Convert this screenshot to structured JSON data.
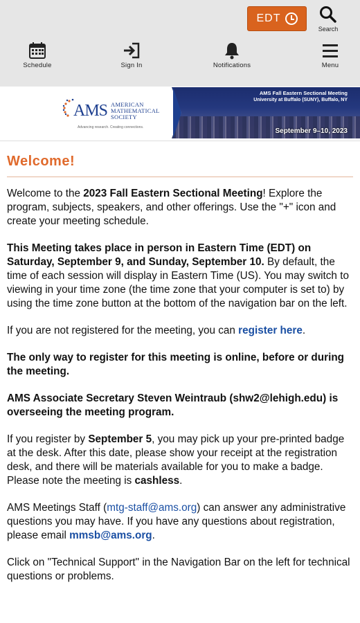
{
  "topbar": {
    "timezone_label": "EDT",
    "search_label": "Search",
    "nav": [
      {
        "label": "Schedule",
        "icon": "calendar-icon"
      },
      {
        "label": "Sign In",
        "icon": "sign-in-icon"
      },
      {
        "label": "Notifications",
        "icon": "bell-icon"
      },
      {
        "label": "Menu",
        "icon": "hamburger-icon"
      }
    ]
  },
  "banner": {
    "logo_abbr": "AMS",
    "logo_name_1": "AMERICAN",
    "logo_name_2": "MATHEMATICAL",
    "logo_name_3": "SOCIETY",
    "logo_tagline": "Advancing research. Creating connections.",
    "meeting_title": "AMS Fall Eastern Sectional Meeting",
    "meeting_location": "University at Buffalo (SUNY), Buffalo, NY",
    "meeting_dates": "September 9–10, 2023"
  },
  "content": {
    "heading": "Welcome!",
    "p1_a": "Welcome to the ",
    "p1_b": "2023 Fall Eastern Sectional Meeting",
    "p1_c": "!  Explore the program, subjects, speakers, and other offerings. Use the \"+\" icon and create your meeting schedule.",
    "p2_a": "This Meeting takes place in person in Eastern Time (EDT) on Saturday, September 9, and Sunday, September 10.",
    "p2_b": " By default, the time of each session will display in Eastern Time (US). You may switch to viewing in your time zone (the time zone that your computer is set to) by using the time zone button at the bottom of the navigation bar on the left.",
    "p3_a": "If you are not registered for the meeting, you can ",
    "p3_link": "register here",
    "p3_c": ".",
    "p4": "The only way to register for this meeting is online, before or during the meeting.",
    "p5": "AMS Associate Secretary Steven Weintraub (shw2@lehigh.edu) is overseeing the meeting program.",
    "p6_a": "If you register by ",
    "p6_b": "September 5",
    "p6_c": ", you may pick up your pre-printed badge at the desk. After this date, please show your receipt at the registration desk, and there will be materials available for you to make a badge. Please note the meeting is ",
    "p6_d": "cashless",
    "p6_e": ".",
    "p7_a": "AMS Meetings Staff (",
    "p7_link1": "mtg-staff@ams.org",
    "p7_b": ") can answer any administrative questions you may have. If you have any questions about registration, please email ",
    "p7_link2": "mmsb@ams.org",
    "p7_c": ".",
    "p8": "Click on \"Technical Support\" in the Navigation Bar on the left for technical questions or problems."
  },
  "colors": {
    "accent_orange": "#d9631e",
    "heading_orange": "#e06a2c",
    "link_blue": "#1a4fa3",
    "topbar_bg": "#e6e6e6"
  }
}
